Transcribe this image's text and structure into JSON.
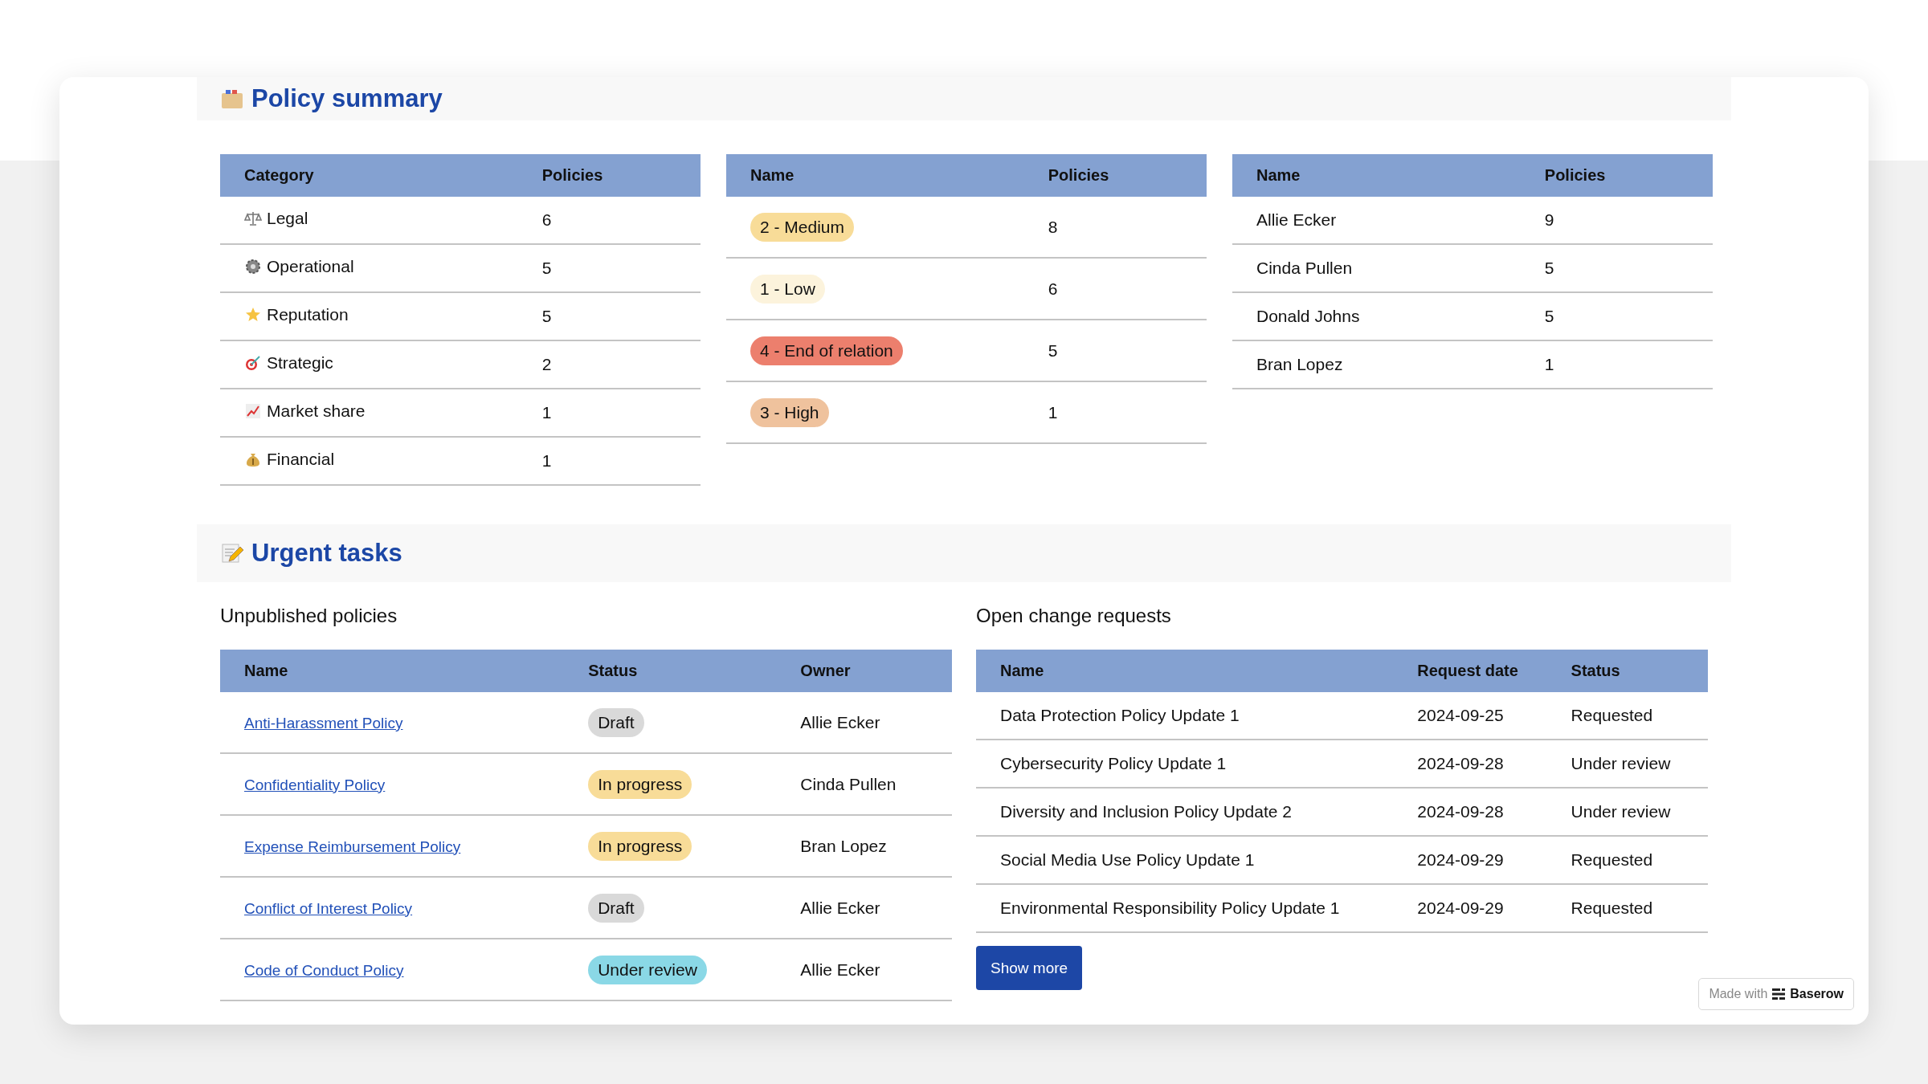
{
  "policy_summary": {
    "title": "Policy summary",
    "categories": {
      "columns": [
        "Category",
        "Policies"
      ],
      "rows": [
        {
          "name": "Legal",
          "count": "6"
        },
        {
          "name": "Operational",
          "count": "5"
        },
        {
          "name": "Reputation",
          "count": "5"
        },
        {
          "name": "Strategic",
          "count": "2"
        },
        {
          "name": "Market share",
          "count": "1"
        },
        {
          "name": "Financial",
          "count": "1"
        }
      ]
    },
    "risk_levels": {
      "columns": [
        "Name",
        "Policies"
      ],
      "rows": [
        {
          "name": "2 - Medium",
          "color": "#f8dc98",
          "count": "8"
        },
        {
          "name": "1 - Low",
          "color": "#fcf3dc",
          "count": "6"
        },
        {
          "name": "4 - End of relation",
          "color": "#ec7f6d",
          "count": "5"
        },
        {
          "name": "3 - High",
          "color": "#efc29d",
          "count": "1"
        }
      ]
    },
    "owners": {
      "columns": [
        "Name",
        "Policies"
      ],
      "rows": [
        {
          "name": "Allie Ecker",
          "count": "9"
        },
        {
          "name": "Cinda Pullen",
          "count": "5"
        },
        {
          "name": "Donald Johns",
          "count": "5"
        },
        {
          "name": "Bran Lopez",
          "count": "1"
        }
      ]
    }
  },
  "urgent_tasks": {
    "title": "Urgent tasks",
    "unpublished": {
      "heading": "Unpublished policies",
      "columns": [
        "Name",
        "Status",
        "Owner"
      ],
      "rows": [
        {
          "name": "Anti-Harassment Policy",
          "status": "Draft",
          "color": "#d9d9d9",
          "owner": "Allie Ecker"
        },
        {
          "name": "Confidentiality Policy",
          "status": "In progress",
          "color": "#f8dc98",
          "owner": "Cinda Pullen"
        },
        {
          "name": "Expense Reimbursement Policy",
          "status": "In progress",
          "color": "#f8dc98",
          "owner": "Bran Lopez"
        },
        {
          "name": "Conflict of Interest Policy",
          "status": "Draft",
          "color": "#d9d9d9",
          "owner": "Allie Ecker"
        },
        {
          "name": "Code of Conduct Policy",
          "status": "Under review",
          "color": "#8ad8e6",
          "owner": "Allie Ecker"
        }
      ]
    },
    "change_requests": {
      "heading": "Open change requests",
      "columns": [
        "Name",
        "Request date",
        "Status"
      ],
      "rows": [
        {
          "name": "Data Protection Policy Update 1",
          "date": "2024-09-25",
          "status": "Requested"
        },
        {
          "name": "Cybersecurity Policy Update 1",
          "date": "2024-09-28",
          "status": "Under review"
        },
        {
          "name": "Diversity and Inclusion Policy Update 2",
          "date": "2024-09-28",
          "status": "Under review"
        },
        {
          "name": "Social Media Use Policy Update 1",
          "date": "2024-09-29",
          "status": "Requested"
        },
        {
          "name": "Environmental Responsibility Policy Update 1",
          "date": "2024-09-29",
          "status": "Requested"
        }
      ],
      "show_more": "Show more"
    }
  },
  "footer_badge": {
    "prefix": "Made with",
    "brand": "Baserow"
  }
}
